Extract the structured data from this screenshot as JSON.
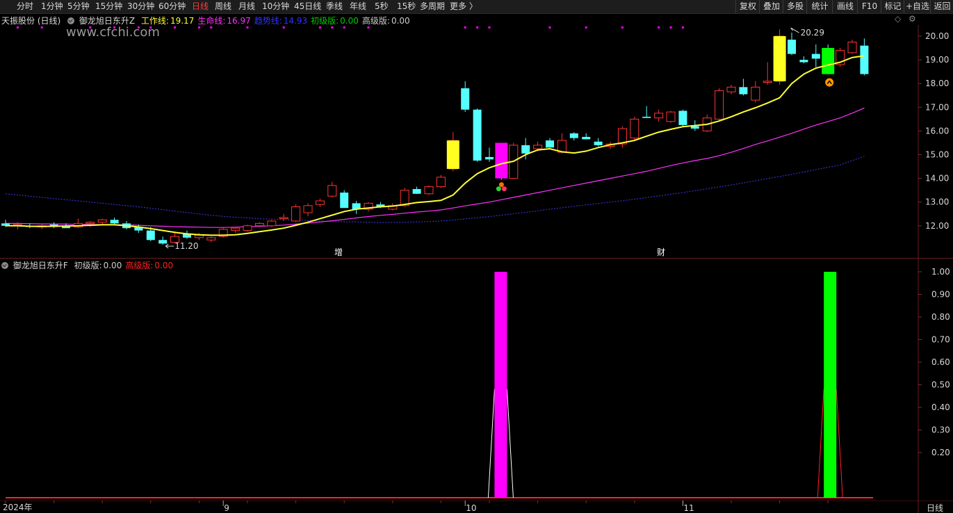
{
  "toolbar": {
    "tabs": [
      "分时",
      "1分钟",
      "5分钟",
      "15分钟",
      "30分钟",
      "60分钟",
      "日线",
      "周线",
      "月线",
      "10分钟",
      "45日线",
      "季线",
      "年线",
      "5秒",
      "15秒",
      "多周期",
      "更多 〉"
    ],
    "active_tab": "日线",
    "right_buttons": [
      "复权",
      "叠加",
      "多股",
      "统计",
      "画线",
      "F10",
      "标记",
      "+自选",
      "返回"
    ]
  },
  "stock": {
    "title": "天振股份 (日线)"
  },
  "main_indicator": {
    "name": "御龙旭日东升Z",
    "items": [
      {
        "label": "工作线:",
        "value": "19.17",
        "color": "#ffff33"
      },
      {
        "label": "生命线:",
        "value": "16.97",
        "color": "#ff33ff"
      },
      {
        "label": "趋势线:",
        "value": "14.93",
        "color": "#3333ff"
      },
      {
        "label": "初级版:",
        "value": "0.00",
        "color": "#00cc00"
      },
      {
        "label": "高级版:",
        "value": "0.00",
        "color": "#cccccc"
      }
    ]
  },
  "sub_indicator": {
    "name": "御龙旭日东升F",
    "items": [
      {
        "label": "初级版:",
        "value": "0.00",
        "color": "#cccccc"
      },
      {
        "label": "高级版:",
        "value": "0.00",
        "color": "#ff2222"
      }
    ]
  },
  "watermark": "www.cfchi.com",
  "annotations": {
    "high": "20.29",
    "low": "11.20",
    "mark1": "增",
    "mark2": "财"
  },
  "price_axis": [
    "20.00",
    "19.00",
    "18.00",
    "17.00",
    "16.00",
    "15.00",
    "14.00",
    "13.00",
    "12.00"
  ],
  "sub_axis": [
    "1.00",
    "0.90",
    "0.80",
    "0.70",
    "0.60",
    "0.50",
    "0.40",
    "0.30",
    "0.20"
  ],
  "date_axis": [
    {
      "label": "2024年"
    },
    {
      "label": "9"
    },
    {
      "label": "10"
    },
    {
      "label": "11"
    }
  ],
  "period_label": "日线",
  "colors": {
    "up": "#ff3333",
    "down": "#55ffff",
    "work": "#ffff33",
    "life": "#ff33ff",
    "trend": "#3333cc",
    "signal1": "#ff00ff",
    "signal2": "#00ff00",
    "yellow_bar": "#ffff22"
  },
  "chart_data": {
    "type": "candlestick",
    "candles": [
      {
        "o": 12.1,
        "h": 12.25,
        "l": 11.95,
        "c": 12.0
      },
      {
        "o": 12.05,
        "h": 12.15,
        "l": 11.85,
        "c": 12.05
      },
      {
        "o": 12.0,
        "h": 12.1,
        "l": 11.9,
        "c": 11.95
      },
      {
        "o": 11.95,
        "h": 12.05,
        "l": 11.85,
        "c": 12.0
      },
      {
        "o": 12.05,
        "h": 12.15,
        "l": 11.9,
        "c": 11.95
      },
      {
        "o": 12.0,
        "h": 12.1,
        "l": 11.9,
        "c": 11.9
      },
      {
        "o": 11.95,
        "h": 12.3,
        "l": 11.9,
        "c": 12.1
      },
      {
        "o": 12.1,
        "h": 12.2,
        "l": 11.95,
        "c": 12.15
      },
      {
        "o": 12.15,
        "h": 12.3,
        "l": 12.05,
        "c": 12.25
      },
      {
        "o": 12.25,
        "h": 12.35,
        "l": 12.05,
        "c": 12.1
      },
      {
        "o": 12.1,
        "h": 12.2,
        "l": 11.85,
        "c": 11.9
      },
      {
        "o": 11.95,
        "h": 12.05,
        "l": 11.7,
        "c": 11.8
      },
      {
        "o": 11.8,
        "h": 11.95,
        "l": 11.35,
        "c": 11.4
      },
      {
        "o": 11.4,
        "h": 11.55,
        "l": 11.2,
        "c": 11.25
      },
      {
        "o": 11.3,
        "h": 11.75,
        "l": 11.25,
        "c": 11.55
      },
      {
        "o": 11.65,
        "h": 11.8,
        "l": 11.45,
        "c": 11.5
      },
      {
        "o": 11.5,
        "h": 11.7,
        "l": 11.4,
        "c": 11.6
      },
      {
        "o": 11.4,
        "h": 11.55,
        "l": 11.3,
        "c": 11.5
      },
      {
        "o": 11.55,
        "h": 11.95,
        "l": 11.5,
        "c": 11.85
      },
      {
        "o": 11.8,
        "h": 11.95,
        "l": 11.7,
        "c": 11.9
      },
      {
        "o": 11.8,
        "h": 12.05,
        "l": 11.75,
        "c": 12.0
      },
      {
        "o": 12.0,
        "h": 12.15,
        "l": 11.95,
        "c": 12.1
      },
      {
        "o": 12.0,
        "h": 12.25,
        "l": 11.95,
        "c": 12.2
      },
      {
        "o": 12.3,
        "h": 12.5,
        "l": 12.2,
        "c": 12.35
      },
      {
        "o": 12.2,
        "h": 12.9,
        "l": 12.15,
        "c": 12.8
      },
      {
        "o": 12.55,
        "h": 12.95,
        "l": 12.4,
        "c": 12.85
      },
      {
        "o": 12.9,
        "h": 13.15,
        "l": 12.8,
        "c": 13.05
      },
      {
        "o": 13.25,
        "h": 13.85,
        "l": 13.2,
        "c": 13.7
      },
      {
        "o": 13.4,
        "h": 13.5,
        "l": 12.8,
        "c": 12.75
      },
      {
        "o": 12.95,
        "h": 13.05,
        "l": 12.5,
        "c": 12.7
      },
      {
        "o": 12.7,
        "h": 13.0,
        "l": 12.6,
        "c": 12.95
      },
      {
        "o": 12.9,
        "h": 13.0,
        "l": 12.75,
        "c": 12.8
      },
      {
        "o": 12.7,
        "h": 12.95,
        "l": 12.65,
        "c": 12.85
      },
      {
        "o": 12.85,
        "h": 13.6,
        "l": 12.8,
        "c": 13.5
      },
      {
        "o": 13.55,
        "h": 13.65,
        "l": 13.35,
        "c": 13.35
      },
      {
        "o": 13.35,
        "h": 13.7,
        "l": 13.3,
        "c": 13.65
      },
      {
        "o": 13.65,
        "h": 14.15,
        "l": 13.6,
        "c": 14.05
      },
      {
        "o": 14.4,
        "h": 15.95,
        "l": 14.3,
        "c": 15.6
      },
      {
        "o": 17.8,
        "h": 18.1,
        "l": 16.8,
        "c": 16.9
      },
      {
        "o": 16.9,
        "h": 16.95,
        "l": 14.7,
        "c": 14.75
      },
      {
        "o": 14.9,
        "h": 15.3,
        "l": 14.7,
        "c": 14.8
      },
      {
        "o": 14.7,
        "h": 14.85,
        "l": 13.95,
        "c": 14.1
      },
      {
        "o": 14.0,
        "h": 15.5,
        "l": 14.0,
        "c": 15.4
      },
      {
        "o": 15.4,
        "h": 15.7,
        "l": 14.8,
        "c": 15.05
      },
      {
        "o": 15.25,
        "h": 15.55,
        "l": 15.15,
        "c": 15.4
      },
      {
        "o": 15.6,
        "h": 15.7,
        "l": 15.3,
        "c": 15.3
      },
      {
        "o": 15.1,
        "h": 15.9,
        "l": 15.05,
        "c": 15.6
      },
      {
        "o": 15.9,
        "h": 15.95,
        "l": 15.6,
        "c": 15.7
      },
      {
        "o": 15.75,
        "h": 15.9,
        "l": 15.65,
        "c": 15.65
      },
      {
        "o": 15.55,
        "h": 15.7,
        "l": 15.35,
        "c": 15.4
      },
      {
        "o": 15.35,
        "h": 15.55,
        "l": 15.25,
        "c": 15.45
      },
      {
        "o": 15.45,
        "h": 16.2,
        "l": 15.3,
        "c": 16.1
      },
      {
        "o": 15.7,
        "h": 16.6,
        "l": 15.6,
        "c": 16.5
      },
      {
        "o": 16.6,
        "h": 17.05,
        "l": 16.55,
        "c": 16.55
      },
      {
        "o": 16.55,
        "h": 16.9,
        "l": 16.4,
        "c": 16.75
      },
      {
        "o": 16.4,
        "h": 16.85,
        "l": 16.35,
        "c": 16.8
      },
      {
        "o": 16.85,
        "h": 16.9,
        "l": 16.2,
        "c": 16.25
      },
      {
        "o": 16.2,
        "h": 16.45,
        "l": 16.0,
        "c": 16.1
      },
      {
        "o": 16.0,
        "h": 16.7,
        "l": 15.95,
        "c": 16.55
      },
      {
        "o": 16.5,
        "h": 17.8,
        "l": 16.4,
        "c": 17.7
      },
      {
        "o": 17.65,
        "h": 17.95,
        "l": 17.55,
        "c": 17.85
      },
      {
        "o": 17.85,
        "h": 18.2,
        "l": 17.5,
        "c": 17.55
      },
      {
        "o": 17.3,
        "h": 18.1,
        "l": 17.2,
        "c": 17.85
      },
      {
        "o": 18.05,
        "h": 18.9,
        "l": 17.95,
        "c": 18.1
      },
      {
        "o": 18.1,
        "h": 20.29,
        "l": 17.95,
        "c": 20.0
      },
      {
        "o": 19.85,
        "h": 20.15,
        "l": 19.2,
        "c": 19.25
      },
      {
        "o": 19.0,
        "h": 19.15,
        "l": 18.85,
        "c": 18.9
      },
      {
        "o": 19.25,
        "h": 19.65,
        "l": 18.7,
        "c": 19.05
      },
      {
        "o": 19.5,
        "h": 19.65,
        "l": 18.4,
        "c": 18.4
      },
      {
        "o": 18.8,
        "h": 19.5,
        "l": 18.7,
        "c": 19.4
      },
      {
        "o": 19.3,
        "h": 19.85,
        "l": 19.25,
        "c": 19.75
      },
      {
        "o": 19.6,
        "h": 19.9,
        "l": 18.35,
        "c": 18.4
      }
    ],
    "work_line": [
      12.0,
      12.0,
      11.98,
      11.97,
      11.98,
      11.99,
      12.0,
      12.02,
      12.04,
      12.04,
      12.0,
      11.95,
      11.88,
      11.8,
      11.72,
      11.66,
      11.62,
      11.6,
      11.6,
      11.62,
      11.68,
      11.75,
      11.82,
      11.9,
      12.02,
      12.15,
      12.3,
      12.45,
      12.6,
      12.7,
      12.75,
      12.8,
      12.83,
      12.9,
      12.98,
      13.02,
      13.07,
      13.3,
      13.8,
      14.2,
      14.45,
      14.62,
      14.72,
      15.0,
      15.2,
      15.25,
      15.12,
      15.07,
      15.15,
      15.3,
      15.42,
      15.5,
      15.6,
      15.78,
      15.95,
      16.07,
      16.18,
      16.23,
      16.28,
      16.42,
      16.6,
      16.8,
      16.98,
      17.18,
      17.4,
      18.0,
      18.4,
      18.65,
      18.78,
      18.9,
      19.1,
      19.17
    ],
    "life_line": [
      12.1,
      12.1,
      12.09,
      12.08,
      12.08,
      12.07,
      12.06,
      12.06,
      12.05,
      12.05,
      12.04,
      12.02,
      12.0,
      11.98,
      11.96,
      11.95,
      11.94,
      11.93,
      11.93,
      11.94,
      11.96,
      11.98,
      12.0,
      12.03,
      12.07,
      12.11,
      12.16,
      12.21,
      12.27,
      12.33,
      12.39,
      12.44,
      12.48,
      12.53,
      12.58,
      12.62,
      12.67,
      12.75,
      12.84,
      12.92,
      13.0,
      13.1,
      13.2,
      13.3,
      13.4,
      13.5,
      13.6,
      13.7,
      13.8,
      13.9,
      14.0,
      14.1,
      14.2,
      14.3,
      14.42,
      14.54,
      14.65,
      14.75,
      14.84,
      14.96,
      15.1,
      15.26,
      15.43,
      15.58,
      15.74,
      15.9,
      16.08,
      16.25,
      16.4,
      16.55,
      16.75,
      16.97
    ],
    "trend_line": [
      13.35,
      13.3,
      13.25,
      13.2,
      13.15,
      13.1,
      13.05,
      13.0,
      12.95,
      12.9,
      12.85,
      12.8,
      12.74,
      12.68,
      12.62,
      12.56,
      12.5,
      12.44,
      12.4,
      12.36,
      12.33,
      12.3,
      12.28,
      12.26,
      12.24,
      12.22,
      12.2,
      12.18,
      12.17,
      12.16,
      12.15,
      12.14,
      12.14,
      12.15,
      12.16,
      12.18,
      12.2,
      12.24,
      12.29,
      12.34,
      12.39,
      12.45,
      12.51,
      12.57,
      12.63,
      12.7,
      12.76,
      12.82,
      12.88,
      12.94,
      13.0,
      13.06,
      13.12,
      13.19,
      13.26,
      13.33,
      13.4,
      13.48,
      13.56,
      13.64,
      13.72,
      13.81,
      13.9,
      13.99,
      14.08,
      14.17,
      14.27,
      14.37,
      14.47,
      14.57,
      14.75,
      14.93
    ],
    "highlight_bars": [
      {
        "index": 37,
        "top": 15.6,
        "bottom": 14.4,
        "color": "yellow"
      },
      {
        "index": 41,
        "top": 15.5,
        "bottom": 14.0,
        "color": "magenta"
      },
      {
        "index": 64,
        "top": 20.0,
        "bottom": 18.1,
        "color": "yellow"
      },
      {
        "index": 68,
        "top": 19.5,
        "bottom": 18.4,
        "color": "green"
      }
    ],
    "signal_dots": [
      1,
      3,
      7,
      9,
      11,
      12,
      14,
      16,
      17,
      20,
      23,
      26,
      27,
      28,
      30,
      38,
      39,
      40,
      45,
      48,
      51,
      54,
      55,
      56
    ],
    "sub_signals": [
      {
        "index": 41,
        "value": 1.0,
        "color": "magenta"
      },
      {
        "index": 68,
        "value": 1.0,
        "color": "green"
      }
    ],
    "date_ticks": [
      {
        "label": "9",
        "index": 18
      },
      {
        "label": "10",
        "index": 38
      },
      {
        "label": "11",
        "index": 56
      }
    ]
  }
}
